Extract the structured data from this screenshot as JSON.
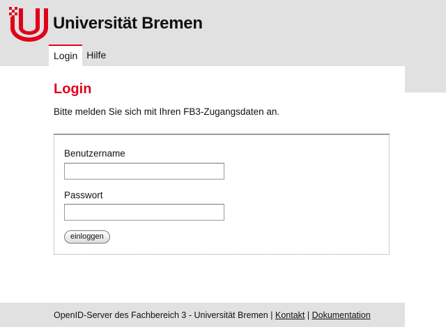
{
  "header": {
    "brand": "Universität Bremen",
    "logo_icon": "university-bremen-logo",
    "accent_color": "#e2001a"
  },
  "nav": {
    "tabs": [
      {
        "label": "Login",
        "active": true
      },
      {
        "label": "Hilfe",
        "active": false
      }
    ]
  },
  "main": {
    "title": "Login",
    "intro": "Bitte melden Sie sich mit Ihren FB3-Zugangsdaten an.",
    "form": {
      "username_label": "Benutzername",
      "username_value": "",
      "password_label": "Passwort",
      "password_value": "",
      "submit_label": "einloggen"
    }
  },
  "footer": {
    "text": "OpenID-Server des Fachbereich 3 - Universität Bremen",
    "separator": "|",
    "link_contact": "Kontakt",
    "link_docs": "Dokumentation"
  }
}
